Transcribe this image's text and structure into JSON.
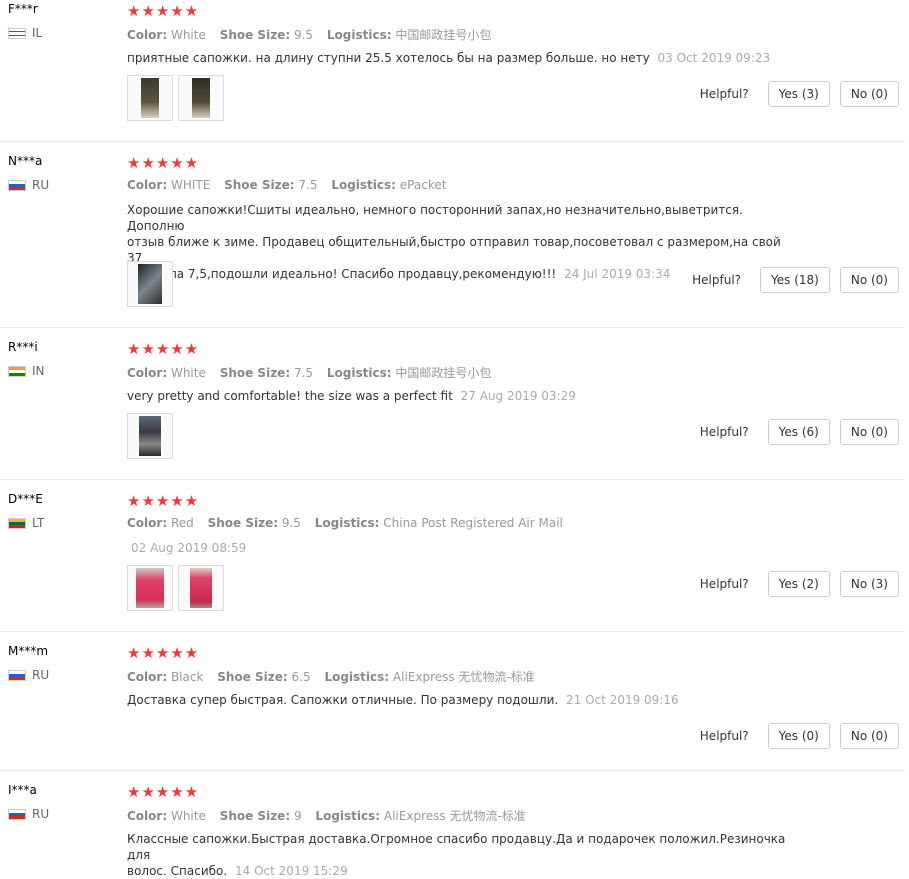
{
  "labels": {
    "color": "Color:",
    "shoe_size": "Shoe Size:",
    "logistics": "Logistics:",
    "helpful": "Helpful?"
  },
  "reviews": [
    {
      "user": "F***r",
      "country": "IL",
      "stars": "★★★★★",
      "color": "White",
      "shoe_size": "9.5",
      "logistics": "中国邮政挂号小包",
      "text": "приятные сапожки. на длину ступни 25.5 хотелось бы на размер больше. но нету",
      "date": "03 Oct 2019 09:23",
      "yes": "Yes (3)",
      "no": "No (0)"
    },
    {
      "user": "N***a",
      "country": "RU",
      "stars": "★★★★★",
      "color": "WHITE",
      "shoe_size": "7.5",
      "logistics": "ePacket",
      "text_lines": [
        "Хорошие сапожки!Сшиты идеально, немного посторонний запах,но незначительно,выветрится. Дополню",
        "отзыв ближе к зиме. Продавец общительный,быстро отправил товар,посоветовал с размером,на свой 37",
        "заказала 7,5,подошли идеально! Спасибо продавцу,рекомендую!!!"
      ],
      "date": "24 Jul 2019 03:34",
      "yes": "Yes (18)",
      "no": "No (0)"
    },
    {
      "user": "R***i",
      "country": "IN",
      "stars": "★★★★★",
      "color": "White",
      "shoe_size": "7.5",
      "logistics": "中国邮政挂号小包",
      "text": "very pretty and comfortable! the size was a perfect fit",
      "date": "27 Aug 2019 03:29",
      "yes": "Yes (6)",
      "no": "No (0)"
    },
    {
      "user": "D***E",
      "country": "LT",
      "stars": "★★★★★",
      "color": "Red",
      "shoe_size": "9.5",
      "logistics": "China Post Registered Air Mail",
      "date": "02 Aug 2019 08:59",
      "yes": "Yes (2)",
      "no": "No (3)"
    },
    {
      "user": "M***m",
      "country": "RU",
      "stars": "★★★★★",
      "color": "Black",
      "shoe_size": "6.5",
      "logistics": "AliExpress 无忧物流-标准",
      "text": "Доставка супер быстрая. Сапожки отличные. По размеру подошли.",
      "date": "21 Oct 2019 09:16",
      "yes": "Yes (0)",
      "no": "No (0)"
    },
    {
      "user": "I***a",
      "country": "RU",
      "stars": "★★★★★",
      "color": "White",
      "shoe_size": "9",
      "logistics": "AliExpress 无忧物流-标准",
      "text_lines": [
        "Классные сапожки.Быстрая доставка.Огромное спасибо продавцу.Да и подарочек положил.Резиночка для",
        "волос. Спасибо."
      ],
      "date": "14 Oct 2019 15:29"
    }
  ],
  "colors": {
    "star": "#f03a3a",
    "muted": "#999999",
    "border": "#e8e8e8"
  }
}
